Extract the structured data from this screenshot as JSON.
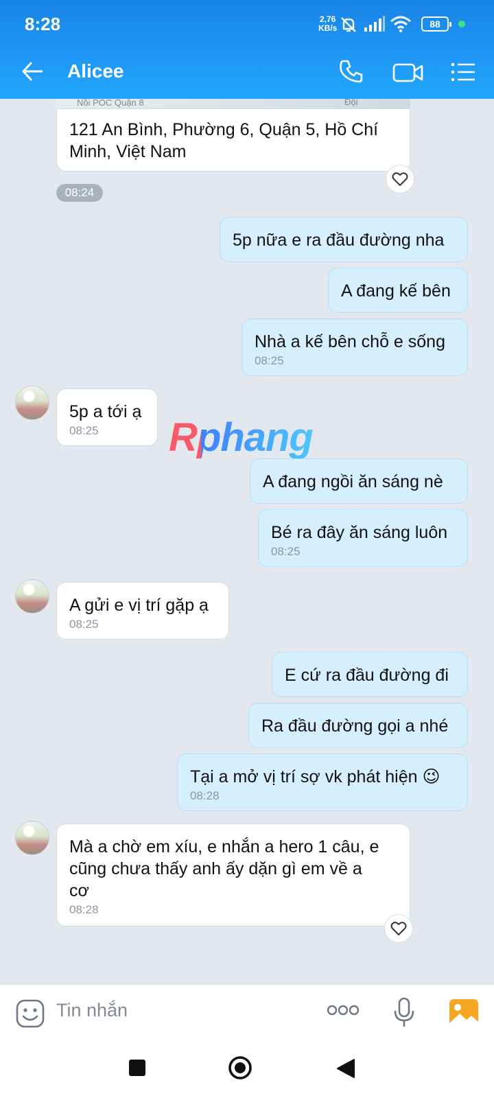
{
  "status_bar": {
    "time": "8:28",
    "speed_value": "2,76",
    "speed_unit": "KB/s",
    "battery": "88"
  },
  "header": {
    "title": "Alicee",
    "accent": "#1d97f5"
  },
  "map_preview": {
    "label_left": "Nồi POC Quận 8",
    "label_right": "Đội"
  },
  "messages": [
    {
      "dir": "in",
      "text": "121 An Bình, Phường 6, Quận 5, Hồ Chí\nMinh, Việt Nam",
      "time": ""
    },
    {
      "dir": "pill",
      "time": "08:24"
    },
    {
      "dir": "out",
      "text": "5p nữa e ra đầu đường nha",
      "time": ""
    },
    {
      "dir": "out",
      "text": "A đang kế bên",
      "time": ""
    },
    {
      "dir": "out",
      "text": "Nhà a kế bên chỗ e sống",
      "time": "08:25"
    },
    {
      "dir": "in",
      "text": "5p a tới ạ",
      "time": "08:25"
    },
    {
      "dir": "out",
      "text": "A đang ngồi ăn sáng nè",
      "time": ""
    },
    {
      "dir": "out",
      "text": "Bé ra đây ăn sáng luôn",
      "time": "08:25"
    },
    {
      "dir": "in",
      "text": "A gửi e vị trí gặp ạ",
      "time": "08:25"
    },
    {
      "dir": "out",
      "text": "E cứ ra đầu đường đi",
      "time": ""
    },
    {
      "dir": "out",
      "text": "Ra đầu đường gọi a nhé",
      "time": ""
    },
    {
      "dir": "out",
      "text": "Tại a mở vị trí sợ vk phát hiện 😉",
      "time": "08:28"
    },
    {
      "dir": "in",
      "text": "Mà a chờ em xíu, e nhắn a hero 1 câu, e\ncũng chưa thấy anh ấy dặn gì em về a\ncơ",
      "time": "08:28"
    }
  ],
  "watermark": "Rphang",
  "input": {
    "placeholder": "Tin nhắn"
  }
}
